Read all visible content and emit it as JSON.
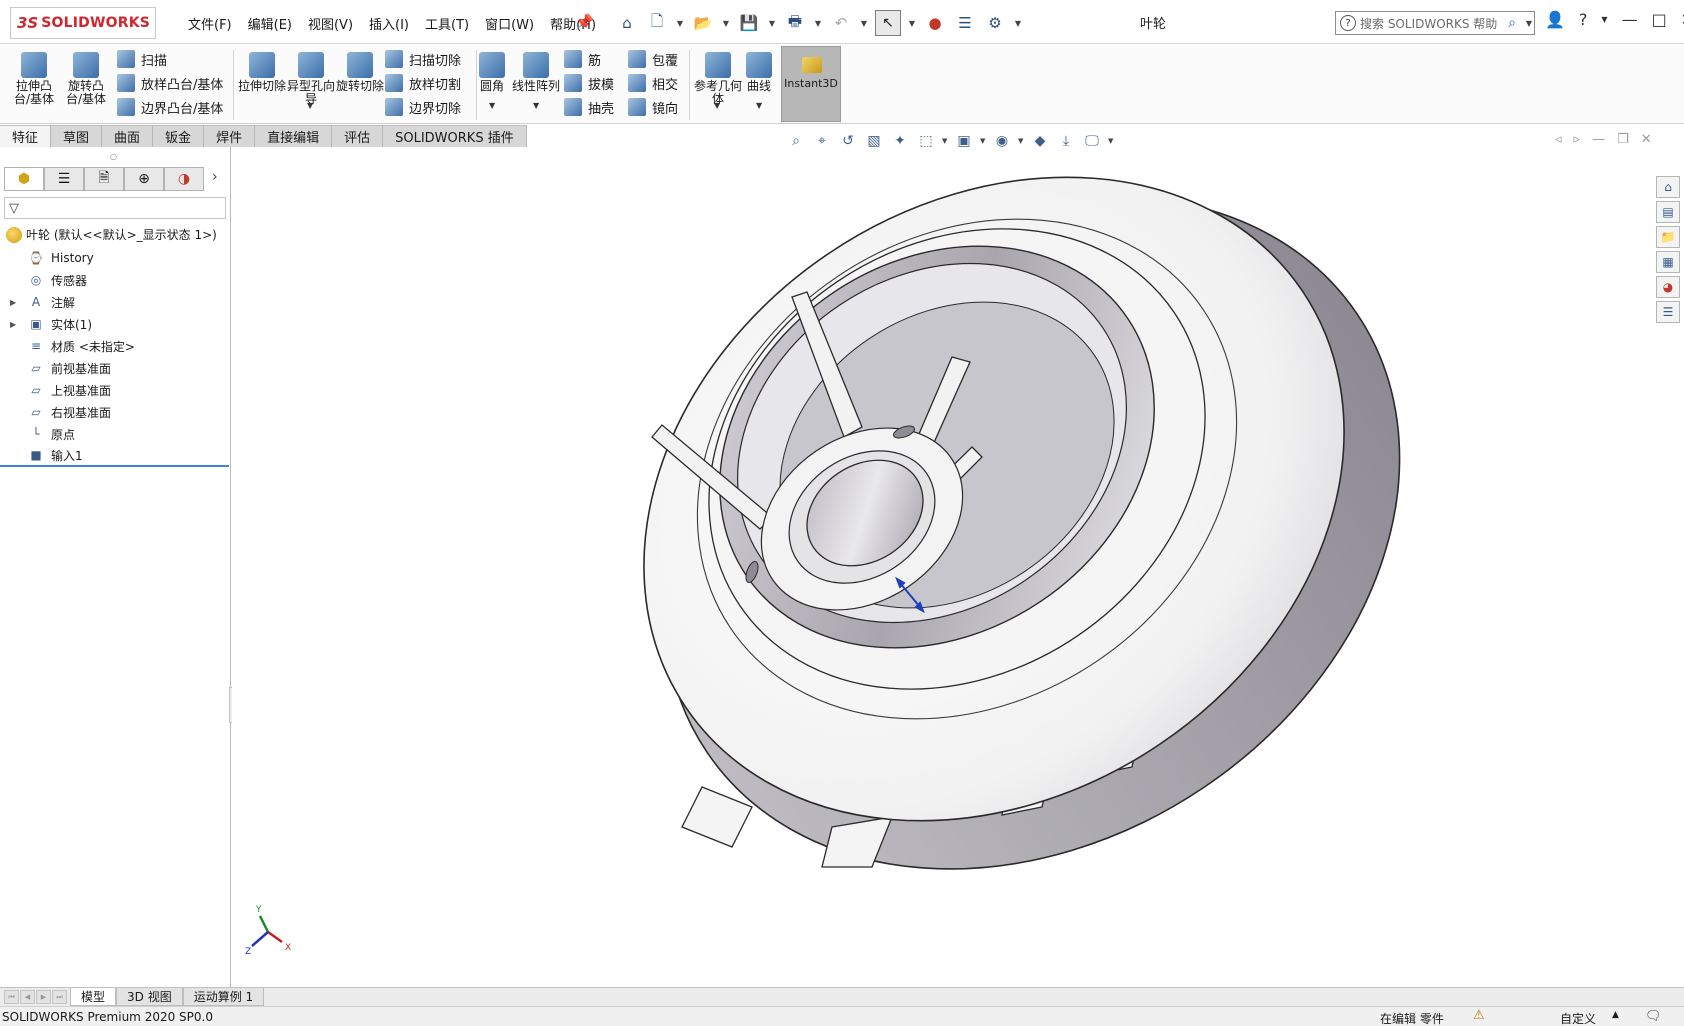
{
  "app": {
    "logo_ds": "3S",
    "logo_text": "SOLIDWORKS",
    "document_title": "叶轮",
    "brand_color": "#d2262c"
  },
  "menu": [
    "文件(F)",
    "编辑(E)",
    "视图(V)",
    "插入(I)",
    "工具(T)",
    "窗口(W)",
    "帮助(H)"
  ],
  "quick_access": {
    "icons": [
      "home-icon",
      "new-document-icon",
      "open-icon",
      "save-icon",
      "print-icon",
      "undo-icon",
      "select-icon",
      "rebuild-icon",
      "file-properties-icon",
      "options-icon"
    ]
  },
  "search": {
    "placeholder": "搜索 SOLIDWORKS 帮助"
  },
  "ribbon": {
    "extrude_boss": "拉伸凸台/基体",
    "revolve_boss": "旋转凸台/基体",
    "sweep": "扫描",
    "loft_boss": "放样凸台/基体",
    "boundary_boss": "边界凸台/基体",
    "extrude_cut": "拉伸切除",
    "hole_wizard": "异型孔向导",
    "revolve_cut": "旋转切除",
    "swept_cut": "扫描切除",
    "lofted_cut": "放样切割",
    "boundary_cut": "边界切除",
    "fillet": "圆角",
    "linear_pattern": "线性阵列",
    "rib": "筋",
    "draft": "拔模",
    "shell": "抽壳",
    "wrap": "包覆",
    "intersect": "相交",
    "mirror": "镜向",
    "ref_geometry": "参考几何体",
    "curves": "曲线",
    "instant3d": "Instant3D"
  },
  "cm_tabs": [
    "特征",
    "草图",
    "曲面",
    "钣金",
    "焊件",
    "直接编辑",
    "评估",
    "SOLIDWORKS 插件"
  ],
  "feature_tree": {
    "root_label": "叶轮 (默认<<默认>_显示状态 1>)",
    "items": [
      {
        "label": "History",
        "icon": "history-icon",
        "expandable": false
      },
      {
        "label": "传感器",
        "icon": "sensor-icon",
        "expandable": false
      },
      {
        "label": "注解",
        "icon": "annotation-icon",
        "expandable": true
      },
      {
        "label": "实体(1)",
        "icon": "solid-bodies-icon",
        "expandable": true
      },
      {
        "label": "材质 <未指定>",
        "icon": "material-icon",
        "expandable": false
      },
      {
        "label": "前视基准面",
        "icon": "plane-icon",
        "expandable": false
      },
      {
        "label": "上视基准面",
        "icon": "plane-icon",
        "expandable": false
      },
      {
        "label": "右视基准面",
        "icon": "plane-icon",
        "expandable": false
      },
      {
        "label": "原点",
        "icon": "origin-icon",
        "expandable": false
      },
      {
        "label": "输入1",
        "icon": "imported-body-icon",
        "expandable": false
      }
    ]
  },
  "triad": {
    "x": "X",
    "y": "Y",
    "z": "Z"
  },
  "bottom_tabs": [
    "模型",
    "3D 视图",
    "运动算例 1"
  ],
  "status": {
    "product": "SOLIDWORKS Premium 2020 SP0.0",
    "editing": "在编辑 零件",
    "units": "自定义"
  }
}
